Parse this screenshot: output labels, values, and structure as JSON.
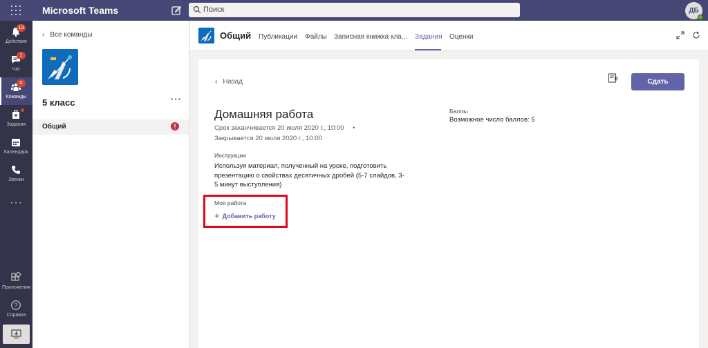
{
  "titlebar": {
    "app_title": "Microsoft Teams",
    "search_placeholder": "Поиск",
    "avatar_initials": "ДБ"
  },
  "rail": {
    "items": [
      {
        "label": "Действия",
        "icon": "bell-icon",
        "badge": "13"
      },
      {
        "label": "Чат",
        "icon": "chat-icon",
        "badge": "1"
      },
      {
        "label": "Команды",
        "icon": "teams-icon",
        "badge": "0",
        "active": true
      },
      {
        "label": "Задания",
        "icon": "assignments-icon",
        "dot": true
      },
      {
        "label": "Календарь",
        "icon": "calendar-icon"
      },
      {
        "label": "Звонки",
        "icon": "phone-icon"
      }
    ],
    "more": "···",
    "apps_label": "Приложения",
    "help_label": "Справка"
  },
  "team_panel": {
    "back_label": "Все команды",
    "team_name": "5 класс",
    "more": "···",
    "channel_name": "Общий",
    "channel_alert": "!"
  },
  "channel_header": {
    "title": "Общий",
    "tabs": [
      {
        "label": "Публикации"
      },
      {
        "label": "Файлы"
      },
      {
        "label": "Записная книжка кла..."
      },
      {
        "label": "Задания",
        "active": true
      },
      {
        "label": "Оценки"
      }
    ]
  },
  "assignment": {
    "back_label": "Назад",
    "submit_label": "Сдать",
    "title": "Домашняя работа",
    "due": "Срок заканчивается 20 июля 2020 г., 10:00",
    "due_bullet": "•",
    "closes": "Закрывается 20 июля 2020 г., 10:00",
    "instructions_label": "Инструкции",
    "instructions": "Используя материал, полученный на уроке, подготовить презентацию о свойствах десятичных дробей (5-7 слайдов, 3-5 минут выступления)",
    "my_work_label": "Моя работа",
    "add_work_label": "Добавить работу",
    "points_label": "Баллы",
    "points_text": "Возможное число баллов: 5"
  },
  "colors": {
    "titlebar": "#464775",
    "rail": "#33344a",
    "accent": "#6264a7",
    "badge": "#cc4a31",
    "highlight": "#e1071b"
  }
}
